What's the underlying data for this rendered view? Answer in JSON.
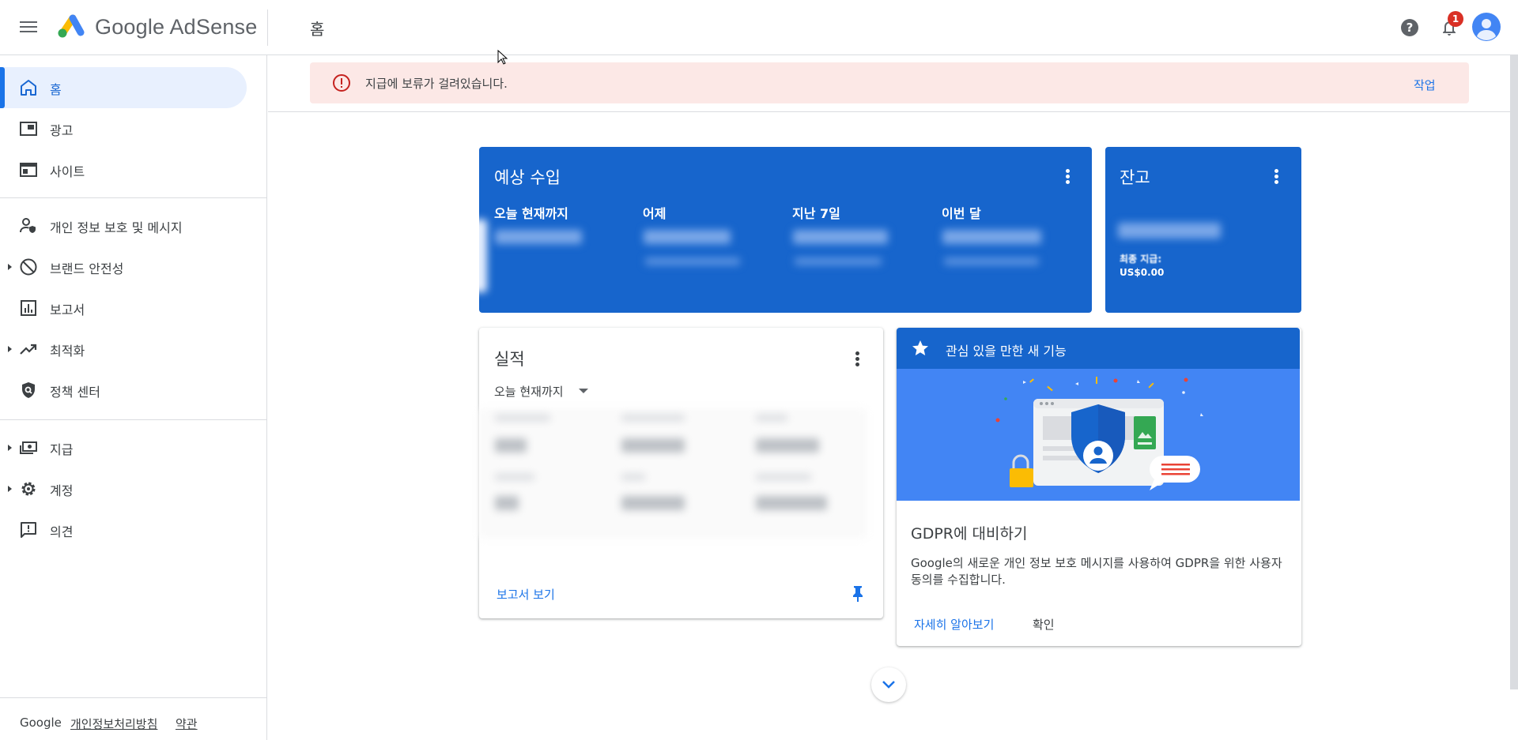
{
  "app": {
    "brand": "Google AdSense",
    "page_title": "홈",
    "notification_count": "1",
    "colors": {
      "accent": "#1a73e8",
      "card_blue": "#1765cc",
      "alert_bg": "#fce8e6",
      "alert_icon": "#c5221f"
    }
  },
  "sidebar": {
    "items": [
      {
        "label": "홈",
        "icon": "home-icon",
        "active": true
      },
      {
        "label": "광고",
        "icon": "ads-icon"
      },
      {
        "label": "사이트",
        "icon": "sites-icon"
      },
      {
        "label": "개인 정보 보호 및 메시지",
        "icon": "privacy-icon"
      },
      {
        "label": "브랜드 안전성",
        "icon": "block-icon",
        "expandable": true
      },
      {
        "label": "보고서",
        "icon": "bar-chart-icon"
      },
      {
        "label": "최적화",
        "icon": "trending-up-icon",
        "expandable": true
      },
      {
        "label": "정책 센터",
        "icon": "shield-icon"
      },
      {
        "label": "지급",
        "icon": "payments-icon",
        "expandable": true
      },
      {
        "label": "계정",
        "icon": "gear-icon",
        "expandable": true
      },
      {
        "label": "의견",
        "icon": "feedback-icon"
      }
    ],
    "footer": {
      "google": "Google",
      "privacy": "개인정보처리방침",
      "terms": "약관"
    }
  },
  "alert": {
    "message": "지급에 보류가 걸려있습니다.",
    "action": "작업"
  },
  "earnings_card": {
    "title": "예상 수입",
    "columns": [
      "오늘 현재까지",
      "어제",
      "지난 7일",
      "이번 달"
    ]
  },
  "balance_card": {
    "title": "잔고",
    "last_payment_label": "최종 지급:",
    "last_payment_value": "US$0.00"
  },
  "performance_card": {
    "title": "실적",
    "range": "오늘 현재까지",
    "report_link": "보고서 보기"
  },
  "feature_card": {
    "header": "관심 있을 만한 새 기능",
    "title": "GDPR에 대비하기",
    "description": "Google의 새로운 개인 정보 보호 메시지를 사용하여 GDPR을 위한 사용자 동의를 수집합니다.",
    "learn_more": "자세히 알아보기",
    "ok": "확인"
  }
}
